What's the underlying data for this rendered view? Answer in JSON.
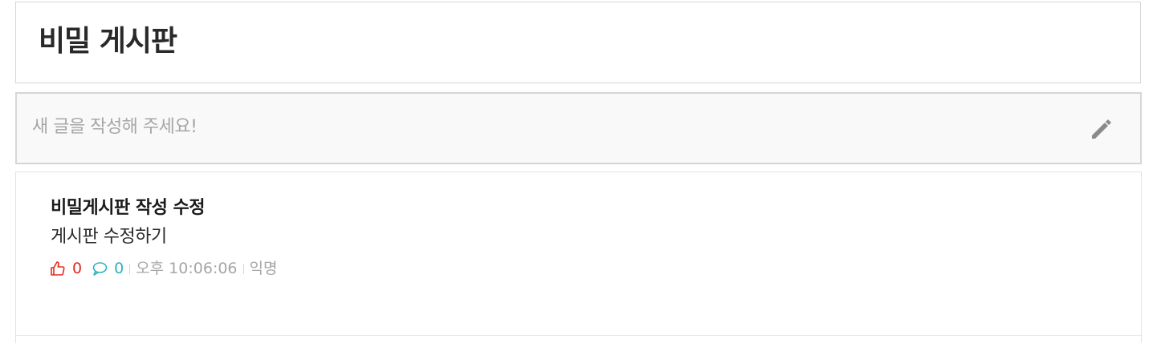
{
  "board": {
    "title": "비밀 게시판"
  },
  "composer": {
    "placeholder": "새 글을 작성해 주세요!",
    "icon": "pencil-icon"
  },
  "posts": [
    {
      "title": "비밀게시판 작성 수정",
      "body": "게시판 수정하기",
      "votes": "0",
      "comments": "0",
      "time": "오후 10:06:06",
      "author": "익명"
    }
  ],
  "colors": {
    "vote": "#e22b1f",
    "comment": "#2bb3c0",
    "meta": "#a6a6a6",
    "border": "#d6d6d6"
  }
}
